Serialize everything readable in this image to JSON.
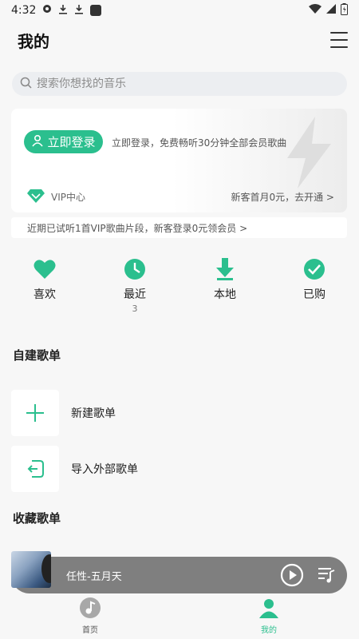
{
  "status": {
    "time": "4:32"
  },
  "header": {
    "title": "我的"
  },
  "search": {
    "placeholder": "搜索你想找的音乐"
  },
  "login_card": {
    "login_label": "立即登录",
    "description": "立即登录，免费畅听30分钟全部会员歌曲",
    "vip_label": "VIP中心",
    "vip_promo": "新客首月0元，去开通 >"
  },
  "notice": {
    "text": "近期已试听1首VIP歌曲片段，新客登录0元领会员 >"
  },
  "quick_actions": [
    {
      "label": "喜欢",
      "icon": "heart-icon"
    },
    {
      "label": "最近",
      "icon": "clock-icon",
      "count": "3"
    },
    {
      "label": "本地",
      "icon": "download-icon"
    },
    {
      "label": "已购",
      "icon": "check-icon"
    }
  ],
  "sections": {
    "self_created": "自建歌单",
    "collected": "收藏歌单"
  },
  "playlists": [
    {
      "label": "新建歌单",
      "icon": "plus-icon"
    },
    {
      "label": "导入外部歌单",
      "icon": "import-icon"
    }
  ],
  "player": {
    "song": "任性-五月天"
  },
  "tabs": [
    {
      "label": "首页",
      "icon": "music-note-icon",
      "active": false
    },
    {
      "label": "我的",
      "icon": "user-icon",
      "active": true
    }
  ],
  "colors": {
    "accent": "#2bbf8e",
    "text": "#222222",
    "background": "#f7f7f7"
  }
}
